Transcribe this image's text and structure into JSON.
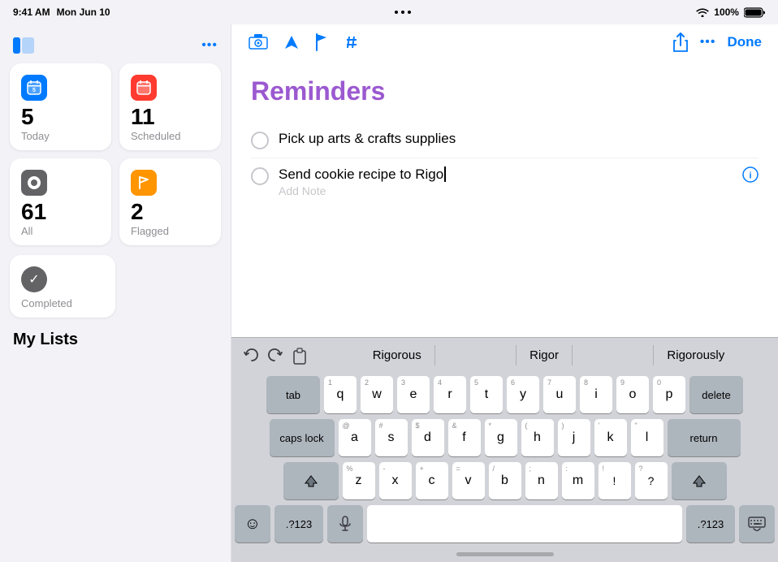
{
  "statusBar": {
    "time": "9:41 AM",
    "date": "Mon Jun 10",
    "dots": "•••",
    "wifi": "WiFi",
    "battery": "100%"
  },
  "sidebar": {
    "panelIconLabel": "panel",
    "ellipsisLabel": "•••",
    "smartLists": [
      {
        "id": "today",
        "label": "Today",
        "count": "5",
        "color": "#007aff",
        "icon": "📅"
      },
      {
        "id": "scheduled",
        "label": "Scheduled",
        "count": "11",
        "color": "#ff3b30",
        "icon": "📅"
      },
      {
        "id": "all",
        "label": "All",
        "count": "61",
        "color": "#000",
        "icon": "⚫"
      },
      {
        "id": "flagged",
        "label": "Flagged",
        "count": "2",
        "color": "#ff9500",
        "icon": "🚩"
      }
    ],
    "completed": {
      "label": "Completed",
      "icon": "✓"
    },
    "myListsHeader": "My Lists"
  },
  "toolbar": {
    "icons": [
      "🖥",
      "➤",
      "🚩",
      "#"
    ],
    "shareLabel": "share",
    "ellipsisLabel": "•••",
    "doneLabel": "Done"
  },
  "mainContent": {
    "title": "Reminders",
    "reminders": [
      {
        "id": "reminder-1",
        "text": "Pick up arts & crafts supplies",
        "hasInfo": false
      },
      {
        "id": "reminder-2",
        "text": "Send cookie recipe to Rigo",
        "addNote": "Add Note",
        "hasInfo": true
      }
    ]
  },
  "autocomplete": {
    "undoLabel": "undo",
    "redoLabel": "redo",
    "pasteLabel": "paste",
    "suggestions": [
      "Rigorous",
      "Rigor",
      "Rigorously"
    ]
  },
  "keyboard": {
    "row1": [
      {
        "key": "q",
        "num": "1"
      },
      {
        "key": "w",
        "num": "2"
      },
      {
        "key": "e",
        "num": "3"
      },
      {
        "key": "r",
        "num": "4"
      },
      {
        "key": "t",
        "num": "5"
      },
      {
        "key": "y",
        "num": "6"
      },
      {
        "key": "u",
        "num": "7"
      },
      {
        "key": "i",
        "num": "8"
      },
      {
        "key": "o",
        "num": "9"
      },
      {
        "key": "p",
        "num": "0"
      }
    ],
    "row2": [
      {
        "key": "a",
        "num": "@"
      },
      {
        "key": "s",
        "num": "#"
      },
      {
        "key": "d",
        "num": "$"
      },
      {
        "key": "f",
        "num": "&"
      },
      {
        "key": "g",
        "num": "*"
      },
      {
        "key": "h",
        "num": "("
      },
      {
        "key": "j",
        "num": ")"
      },
      {
        "key": "k",
        "num": "'"
      },
      {
        "key": "l",
        "num": "\""
      }
    ],
    "row3": [
      {
        "key": "z",
        "num": "%"
      },
      {
        "key": "x",
        "num": "-"
      },
      {
        "key": "c",
        "num": "+"
      },
      {
        "key": "v",
        "num": "="
      },
      {
        "key": "b",
        "num": "/"
      },
      {
        "key": "n",
        "num": ";"
      },
      {
        "key": "m",
        "num": ":"
      },
      {
        "key": "!",
        "num": "!"
      },
      {
        "key": "?",
        "num": "?"
      }
    ],
    "labels": {
      "tab": "tab",
      "delete": "delete",
      "capsLock": "caps lock",
      "return": "return",
      "shift": "shift",
      "emoji": "☺",
      "numbers": ".?123",
      "microphone": "mic",
      "space": "",
      "keyboard": "⌨"
    }
  }
}
